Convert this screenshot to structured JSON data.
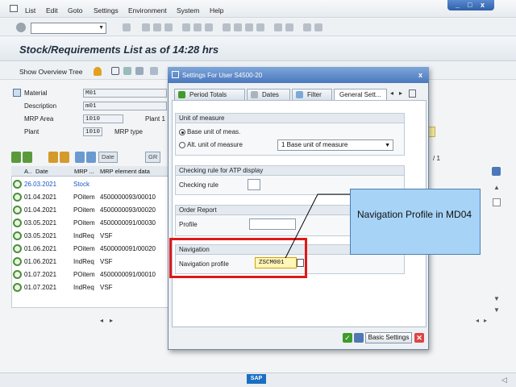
{
  "menu": {
    "items": [
      "List",
      "Edit",
      "Goto",
      "Settings",
      "Environment",
      "System",
      "Help"
    ]
  },
  "window_controls": {
    "minimize": "_",
    "restore": "□",
    "close": "x"
  },
  "title": "Stock/Requirements List as of 14:28 hrs",
  "app_toolbar": {
    "show_overview_tree": "Show Overview Tree"
  },
  "header": {
    "material_label": "Material",
    "material_value": "M01",
    "description_label": "Description",
    "description_value": "m01",
    "mrp_area_label": "MRP Area",
    "mrp_area_value": "1010",
    "plant1_label": "Plant 1",
    "plant_label": "Plant",
    "plant_value": "1010",
    "mrp_type_label": "MRP type",
    "page_info": "/ 1"
  },
  "grid": {
    "toolbar": {
      "date_btn": "Date",
      "gr_btn": "GR"
    },
    "headers": [
      "A..",
      "Date",
      "MRP ...",
      "MRP element data"
    ],
    "rows": [
      {
        "date": "26.03.2021",
        "mrp": "Stock",
        "data": ""
      },
      {
        "date": "01.04.2021",
        "mrp": "POitem",
        "data": "4500000093/00010"
      },
      {
        "date": "01.04.2021",
        "mrp": "POitem",
        "data": "4500000093/00020"
      },
      {
        "date": "03.05.2021",
        "mrp": "POitem",
        "data": "4500000091/00030"
      },
      {
        "date": "03.05.2021",
        "mrp": "IndReq",
        "data": "VSF"
      },
      {
        "date": "01.06.2021",
        "mrp": "POitem",
        "data": "4500000091/00020"
      },
      {
        "date": "01.06.2021",
        "mrp": "IndReq",
        "data": "VSF"
      },
      {
        "date": "01.07.2021",
        "mrp": "POitem",
        "data": "4500000091/00010"
      },
      {
        "date": "01.07.2021",
        "mrp": "IndReq",
        "data": "VSF"
      }
    ]
  },
  "dialog": {
    "title": "Settings For User S4500-20",
    "close": "x",
    "tabs": [
      "Period Totals",
      "Dates",
      "Filter",
      "General Sett..."
    ],
    "unit_group": {
      "title": "Unit of measure",
      "opt_base": "Base unit of meas.",
      "opt_alt": "Alt. unit of measure",
      "alt_select_value": "1 Base unit of measure"
    },
    "atp_group": {
      "title": "Checking rule for ATP display",
      "label": "Checking rule"
    },
    "order_group": {
      "title": "Order Report",
      "label": "Profile"
    },
    "nav_group": {
      "title": "Navigation",
      "label": "Navigation profile",
      "value": "ZSCM001"
    },
    "basic_settings": "Basic Settings"
  },
  "callout": {
    "text": "Navigation Profile in MD04"
  },
  "statusbar": {
    "logo": "SAP"
  },
  "colors": {
    "highlight": "#e01818",
    "callout_bg": "#a7d3f7",
    "dialog_title": "#4a78bd"
  }
}
